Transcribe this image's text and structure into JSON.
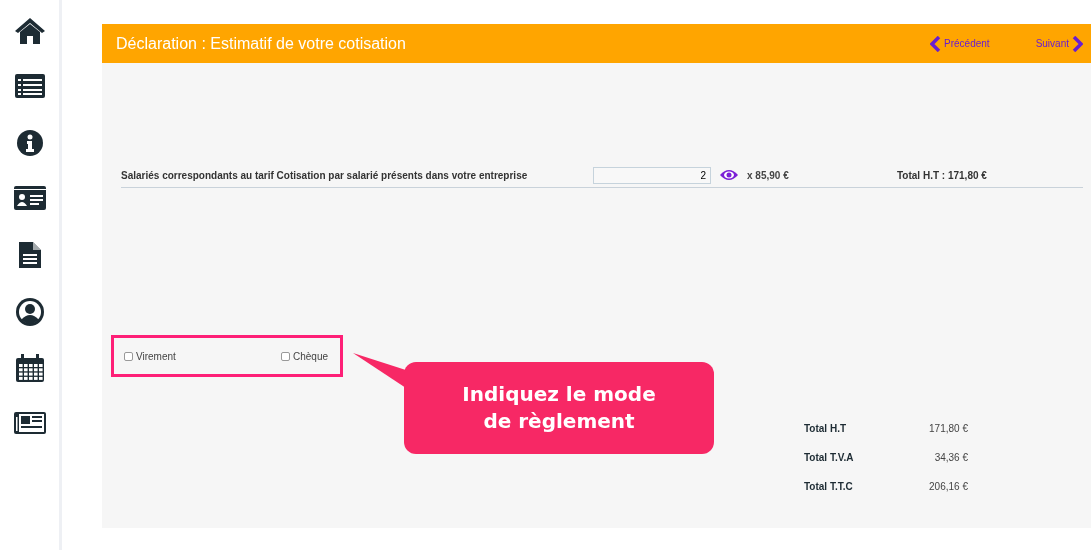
{
  "sidebar": {
    "items": [
      {
        "kind": "home"
      },
      {
        "kind": "list"
      },
      {
        "kind": "info"
      },
      {
        "kind": "card"
      },
      {
        "kind": "document"
      },
      {
        "kind": "user"
      },
      {
        "kind": "calendar"
      },
      {
        "kind": "news"
      }
    ]
  },
  "header": {
    "title": "Déclaration : Estimatif de votre cotisation",
    "nav": [
      {
        "kind": "prev",
        "label": "Précédent"
      },
      {
        "kind": "next",
        "label": "Suivant"
      }
    ]
  },
  "line_item": {
    "label": "Salariés correspondants au tarif Cotisation par salarié présents dans votre entreprise",
    "quantity": "2",
    "unit_price": "x 85,90 €",
    "total": "Total H.T : 171,80 €"
  },
  "payment_methods": [
    {
      "label": "Virement",
      "checked": false
    },
    {
      "label": "Chèque",
      "checked": false
    }
  ],
  "callout": {
    "text": "Indiquez le mode de règlement"
  },
  "totals": [
    {
      "label": "Total H.T",
      "value": "171,80 €"
    },
    {
      "label": "Total T.V.A",
      "value": "34,36 €"
    },
    {
      "label": "Total T.T.C",
      "value": "206,16 €"
    }
  ]
}
